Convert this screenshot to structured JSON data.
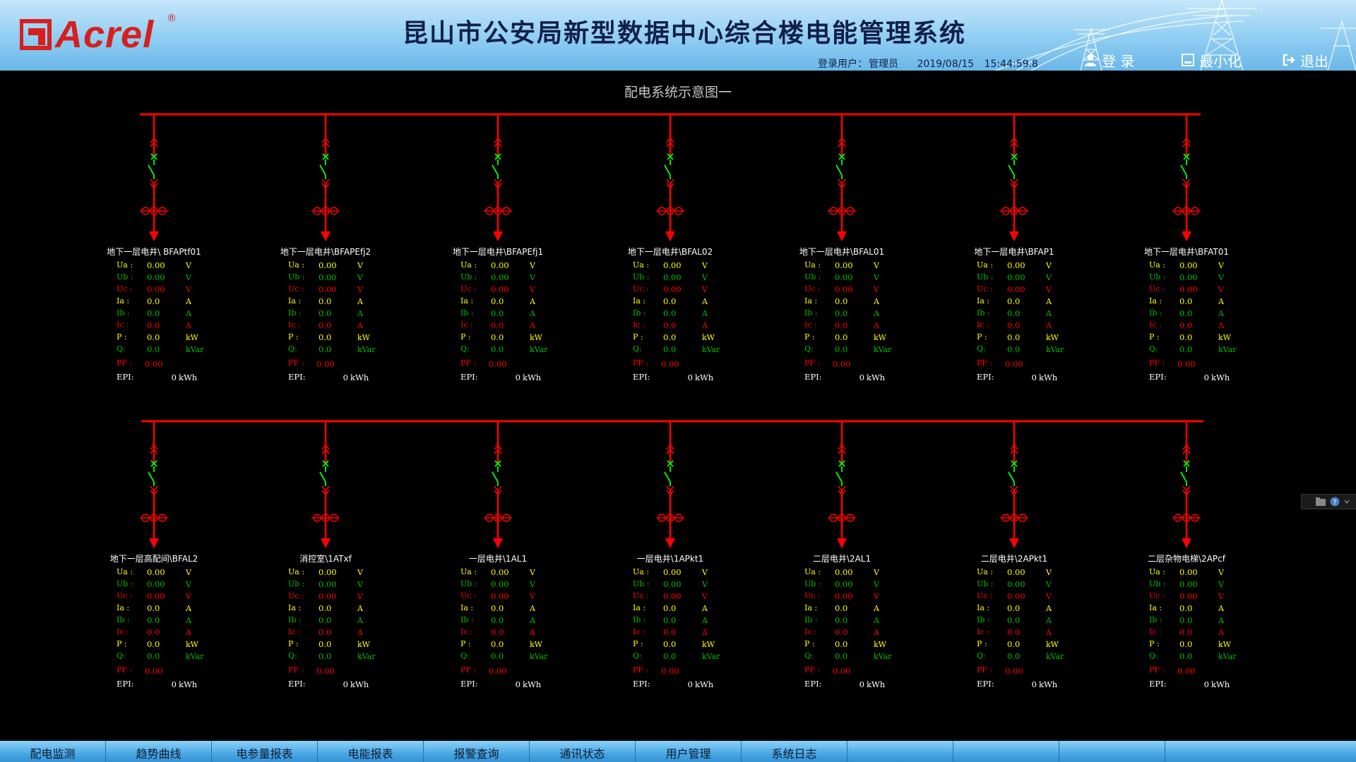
{
  "header": {
    "logo_text": "Acrel",
    "logo_reg": "®",
    "title": "昆山市公安局新型数据中心综合楼电能管理系统",
    "user_label": "登录用户：",
    "user_name": "管理员",
    "date": "2019/08/15",
    "time": "15:44:59.8",
    "login_label": "登 录",
    "minimize_label": "最小化",
    "exit_label": "退出"
  },
  "diagram": {
    "title": "配电系统示意图一",
    "param_labels": {
      "ua": "Ua :",
      "ub": "Ub :",
      "uc": "Uc :",
      "ia": "Ia :",
      "ib": "Ib :",
      "ic": "Ic :",
      "p": "P :",
      "q": "Q:",
      "pf": "PF :",
      "epi": "EPI:"
    },
    "units": {
      "v": "V",
      "a": "A",
      "kw": "kW",
      "kvar": "kVar",
      "kwh": "kWh"
    },
    "colors": {
      "red": "#ff0000",
      "yellow": "#ffff00",
      "green": "#00c000",
      "switch": "#00ff00"
    },
    "rows": [
      {
        "feeders": [
          {
            "name": "地下一层电井\\ BFAPtf01",
            "ua": "0.00",
            "ub": "0.00",
            "uc": "0.00",
            "ia": "0.0",
            "ib": "0.0",
            "ic": "0.0",
            "p": "0.0",
            "q": "0.0",
            "pf": "0.00",
            "epi": "0"
          },
          {
            "name": "地下一层电井\\BFAPEfj2",
            "ua": "0.00",
            "ub": "0.00",
            "uc": "0.00",
            "ia": "0.0",
            "ib": "0.0",
            "ic": "0.0",
            "p": "0.0",
            "q": "0.0",
            "pf": "0.00",
            "epi": "0"
          },
          {
            "name": "地下一层电井\\BFAPEfj1",
            "ua": "0.00",
            "ub": "0.00",
            "uc": "0.00",
            "ia": "0.0",
            "ib": "0.0",
            "ic": "0.0",
            "p": "0.0",
            "q": "0.0",
            "pf": "0.00",
            "epi": "0"
          },
          {
            "name": "地下一层电井\\BFAL02",
            "ua": "0.00",
            "ub": "0.00",
            "uc": "0.00",
            "ia": "0.0",
            "ib": "0.0",
            "ic": "0.0",
            "p": "0.0",
            "q": "0.0",
            "pf": "0.00",
            "epi": "0"
          },
          {
            "name": "地下一层电井\\BFAL01",
            "ua": "0.00",
            "ub": "0.00",
            "uc": "0.00",
            "ia": "0.0",
            "ib": "0.0",
            "ic": "0.0",
            "p": "0.0",
            "q": "0.0",
            "pf": "0.00",
            "epi": "0"
          },
          {
            "name": "地下一层电井\\BFAP1",
            "ua": "0.00",
            "ub": "0.00",
            "uc": "0.00",
            "ia": "0.0",
            "ib": "0.0",
            "ic": "0.0",
            "p": "0.0",
            "q": "0.0",
            "pf": "0.00",
            "epi": "0"
          },
          {
            "name": "地下一层电井\\BFAT01",
            "ua": "0.00",
            "ub": "0.00",
            "uc": "0.00",
            "ia": "0.0",
            "ib": "0.0",
            "ic": "0.0",
            "p": "0.0",
            "q": "0.0",
            "pf": "0.00",
            "epi": "0"
          }
        ]
      },
      {
        "feeders": [
          {
            "name": "地下一层高配间\\BFAL2",
            "ua": "0.00",
            "ub": "0.00",
            "uc": "0.00",
            "ia": "0.0",
            "ib": "0.0",
            "ic": "0.0",
            "p": "0.0",
            "q": "0.0",
            "pf": "0.00",
            "epi": "0"
          },
          {
            "name": "消控室\\1ATxf",
            "ua": "0.00",
            "ub": "0.00",
            "uc": "0.00",
            "ia": "0.0",
            "ib": "0.0",
            "ic": "0.0",
            "p": "0.0",
            "q": "0.0",
            "pf": "0.00",
            "epi": "0"
          },
          {
            "name": "一层电井\\1AL1",
            "ua": "0.00",
            "ub": "0.00",
            "uc": "0.00",
            "ia": "0.0",
            "ib": "0.0",
            "ic": "0.0",
            "p": "0.0",
            "q": "0.0",
            "pf": "0.00",
            "epi": "0"
          },
          {
            "name": "一层电井\\1APkt1",
            "ua": "0.00",
            "ub": "0.00",
            "uc": "0.00",
            "ia": "0.0",
            "ib": "0.0",
            "ic": "0.0",
            "p": "0.0",
            "q": "0.0",
            "pf": "0.00",
            "epi": "0"
          },
          {
            "name": "二层电井\\2AL1",
            "ua": "0.00",
            "ub": "0.00",
            "uc": "0.00",
            "ia": "0.0",
            "ib": "0.0",
            "ic": "0.0",
            "p": "0.0",
            "q": "0.0",
            "pf": "0.00",
            "epi": "0"
          },
          {
            "name": "二层电井\\2APkt1",
            "ua": "0.00",
            "ub": "0.00",
            "uc": "0.00",
            "ia": "0.0",
            "ib": "0.0",
            "ic": "0.0",
            "p": "0.0",
            "q": "0.0",
            "pf": "0.00",
            "epi": "0"
          },
          {
            "name": "二层杂物电梯\\2APcf",
            "ua": "0.00",
            "ub": "0.00",
            "uc": "0.00",
            "ia": "0.0",
            "ib": "0.0",
            "ic": "0.0",
            "p": "0.0",
            "q": "0.0",
            "pf": "0.00",
            "epi": "0"
          }
        ]
      }
    ]
  },
  "nav": {
    "items": [
      "配电监测",
      "趋势曲线",
      "电参量报表",
      "电能报表",
      "报警查询",
      "通讯状态",
      "用户管理",
      "系统日志",
      "",
      "",
      ""
    ]
  },
  "icons": {
    "login": "user-icon",
    "minimize": "minimize-icon",
    "exit": "exit-icon",
    "feeder_symbols": [
      "disconnector-icon",
      "breaker-icon",
      "ct-icon",
      "arrow-down-icon"
    ]
  }
}
